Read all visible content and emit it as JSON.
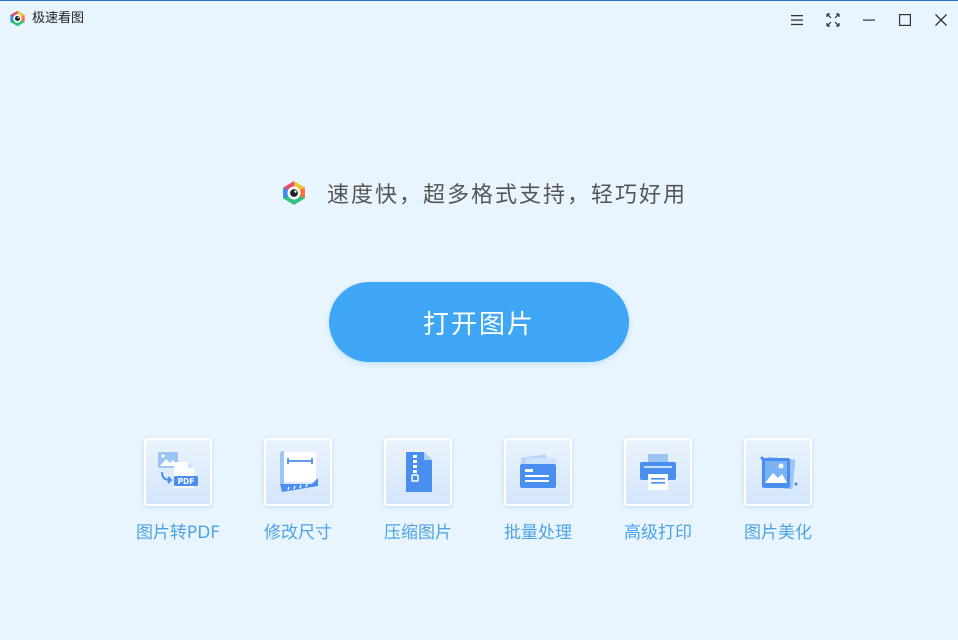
{
  "app": {
    "title": "极速看图"
  },
  "window_controls": [
    "menu-icon",
    "fullscreen-icon",
    "minimize-icon",
    "maximize-icon",
    "close-icon"
  ],
  "main": {
    "slogan": "速度快，超多格式支持，轻巧好用",
    "open_button_label": "打开图片"
  },
  "tools": [
    {
      "label": "图片转PDF",
      "icon": "image-to-pdf-icon"
    },
    {
      "label": "修改尺寸",
      "icon": "resize-ruler-icon"
    },
    {
      "label": "压缩图片",
      "icon": "zip-file-icon"
    },
    {
      "label": "批量处理",
      "icon": "batch-images-icon"
    },
    {
      "label": "高级打印",
      "icon": "printer-icon"
    },
    {
      "label": "图片美化",
      "icon": "beautify-image-icon"
    }
  ],
  "colors": {
    "background": "#e9f5fe",
    "accent": "#3fa6f6",
    "tool_label": "#4ea3e4",
    "icon_blue": "#4a8ff0"
  }
}
